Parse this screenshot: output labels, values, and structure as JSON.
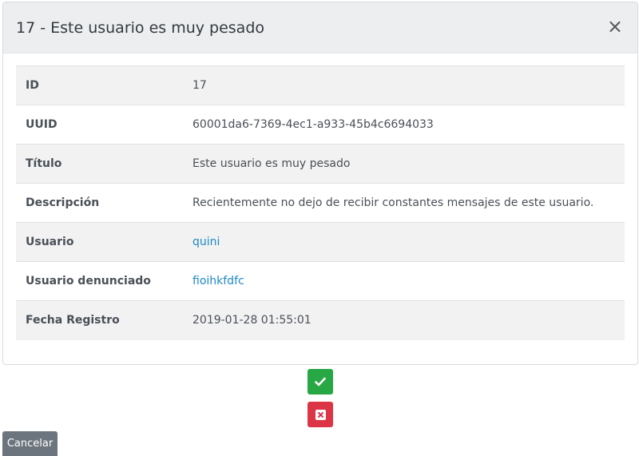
{
  "modal": {
    "title": "17 - Este usuario es muy pesado",
    "close_symbol": "×"
  },
  "details": {
    "rows": [
      {
        "label": "ID",
        "value": "17"
      },
      {
        "label": "UUID",
        "value": "60001da6-7369-4ec1-a933-45b4c6694033"
      },
      {
        "label": "Título",
        "value": "Este usuario es muy pesado"
      },
      {
        "label": "Descripción",
        "value": "Recientemente no dejo de recibir constantes mensajes de este usuario."
      },
      {
        "label": "Usuario",
        "value": "quini"
      },
      {
        "label": "Usuario denunciado",
        "value": "fioihkfdfc"
      },
      {
        "label": "Fecha Registro",
        "value": "2019-01-28 01:55:01"
      }
    ]
  },
  "actions": {
    "approve_icon": "check-icon",
    "reject_icon": "close-square-icon",
    "cancel_label": "Cancelar"
  },
  "colors": {
    "approve": "#28a745",
    "reject": "#dc3545",
    "cancel": "#6c757d",
    "link": "#1e88c8"
  }
}
